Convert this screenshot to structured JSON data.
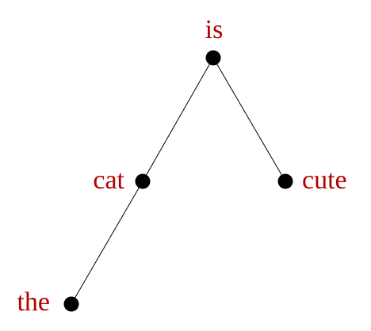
{
  "tree": {
    "label_color": "#b30000",
    "nodes": [
      {
        "id": "is",
        "label": "is"
      },
      {
        "id": "cat",
        "label": "cat"
      },
      {
        "id": "cute",
        "label": "cute"
      },
      {
        "id": "the",
        "label": "the"
      }
    ],
    "edges": [
      {
        "from": "is",
        "to": "cat"
      },
      {
        "from": "is",
        "to": "cute"
      },
      {
        "from": "cat",
        "to": "the"
      }
    ]
  }
}
